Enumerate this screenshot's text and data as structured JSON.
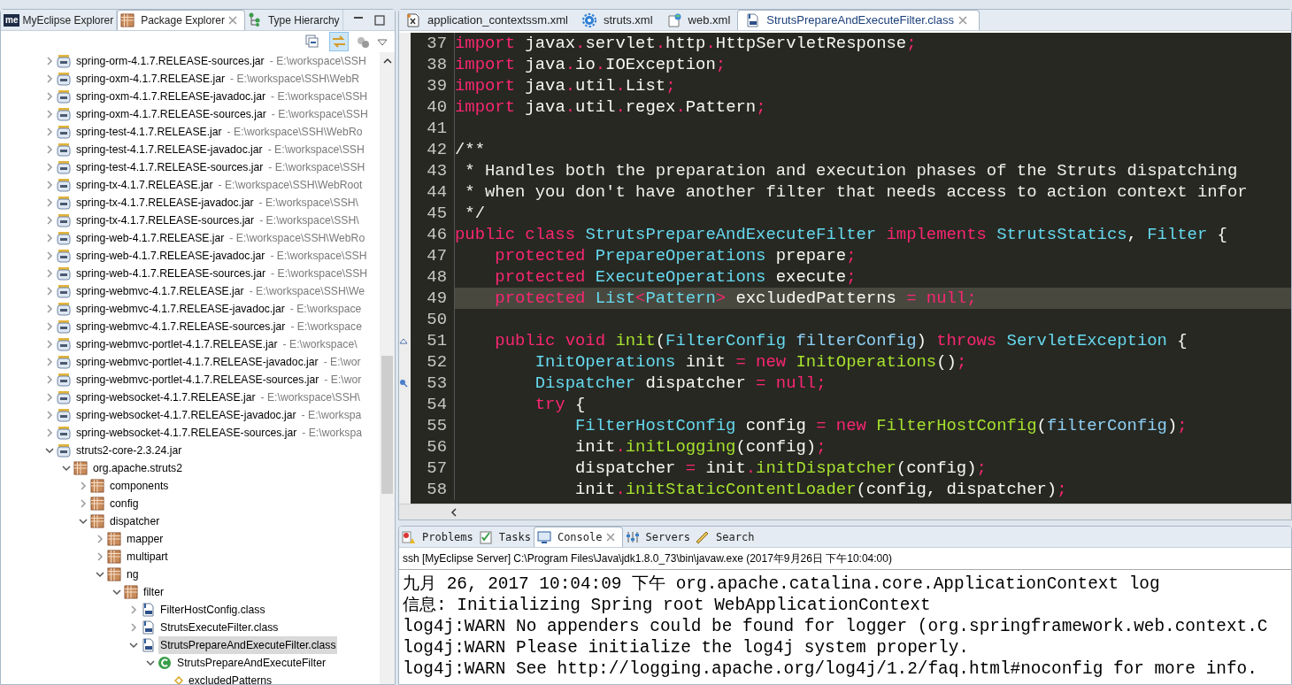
{
  "explorer": {
    "logo": "me",
    "tabs": [
      {
        "label": "MyEclipse Explorer",
        "selected": false
      },
      {
        "label": "Package Explorer",
        "selected": true
      },
      {
        "label": "Type Hierarchy",
        "selected": false
      }
    ],
    "link_with_editor": {
      "on": true
    },
    "tree": [
      {
        "label": "spring-orm-4.1.7.RELEASE-sources.jar",
        "path": "- E:\\workspace\\SSH",
        "kind": "jar",
        "expanded": false
      },
      {
        "label": "spring-oxm-4.1.7.RELEASE.jar",
        "path": "- E:\\workspace\\SSH\\WebR",
        "kind": "jar",
        "expanded": false
      },
      {
        "label": "spring-oxm-4.1.7.RELEASE-javadoc.jar",
        "path": "- E:\\workspace\\SSH",
        "kind": "jar",
        "expanded": false
      },
      {
        "label": "spring-oxm-4.1.7.RELEASE-sources.jar",
        "path": "- E:\\workspace\\SSH",
        "kind": "jar",
        "expanded": false
      },
      {
        "label": "spring-test-4.1.7.RELEASE.jar",
        "path": "- E:\\workspace\\SSH\\WebRo",
        "kind": "jar",
        "expanded": false
      },
      {
        "label": "spring-test-4.1.7.RELEASE-javadoc.jar",
        "path": "- E:\\workspace\\SSH",
        "kind": "jar",
        "expanded": false
      },
      {
        "label": "spring-test-4.1.7.RELEASE-sources.jar",
        "path": "- E:\\workspace\\SSH",
        "kind": "jar",
        "expanded": false
      },
      {
        "label": "spring-tx-4.1.7.RELEASE.jar",
        "path": "- E:\\workspace\\SSH\\WebRoot",
        "kind": "jar",
        "expanded": false
      },
      {
        "label": "spring-tx-4.1.7.RELEASE-javadoc.jar",
        "path": "- E:\\workspace\\SSH\\",
        "kind": "jar",
        "expanded": false
      },
      {
        "label": "spring-tx-4.1.7.RELEASE-sources.jar",
        "path": "- E:\\workspace\\SSH\\",
        "kind": "jar",
        "expanded": false
      },
      {
        "label": "spring-web-4.1.7.RELEASE.jar",
        "path": "- E:\\workspace\\SSH\\WebRo",
        "kind": "jar",
        "expanded": false
      },
      {
        "label": "spring-web-4.1.7.RELEASE-javadoc.jar",
        "path": "- E:\\workspace\\SSH",
        "kind": "jar",
        "expanded": false
      },
      {
        "label": "spring-web-4.1.7.RELEASE-sources.jar",
        "path": "- E:\\workspace\\SSH",
        "kind": "jar",
        "expanded": false
      },
      {
        "label": "spring-webmvc-4.1.7.RELEASE.jar",
        "path": "- E:\\workspace\\SSH\\We",
        "kind": "jar",
        "expanded": false
      },
      {
        "label": "spring-webmvc-4.1.7.RELEASE-javadoc.jar",
        "path": "- E:\\workspace",
        "kind": "jar",
        "expanded": false
      },
      {
        "label": "spring-webmvc-4.1.7.RELEASE-sources.jar",
        "path": "- E:\\workspace",
        "kind": "jar",
        "expanded": false
      },
      {
        "label": "spring-webmvc-portlet-4.1.7.RELEASE.jar",
        "path": "- E:\\workspace\\",
        "kind": "jar",
        "expanded": false
      },
      {
        "label": "spring-webmvc-portlet-4.1.7.RELEASE-javadoc.jar",
        "path": "- E:\\wor",
        "kind": "jar",
        "expanded": false
      },
      {
        "label": "spring-webmvc-portlet-4.1.7.RELEASE-sources.jar",
        "path": "- E:\\wor",
        "kind": "jar",
        "expanded": false
      },
      {
        "label": "spring-websocket-4.1.7.RELEASE.jar",
        "path": "- E:\\workspace\\SSH\\",
        "kind": "jar",
        "expanded": false
      },
      {
        "label": "spring-websocket-4.1.7.RELEASE-javadoc.jar",
        "path": "- E:\\workspa",
        "kind": "jar",
        "expanded": false
      },
      {
        "label": "spring-websocket-4.1.7.RELEASE-sources.jar",
        "path": "- E:\\workspa",
        "kind": "jar",
        "expanded": false
      },
      {
        "label": "struts2-core-2.3.24.jar",
        "kind": "jar",
        "expanded": true,
        "children": [
          {
            "label": "org.apache.struts2",
            "kind": "package",
            "expanded": true,
            "children": [
              {
                "label": "components",
                "kind": "package",
                "expanded": false
              },
              {
                "label": "config",
                "kind": "package",
                "expanded": false
              },
              {
                "label": "dispatcher",
                "kind": "package",
                "expanded": true,
                "children": [
                  {
                    "label": "mapper",
                    "kind": "package",
                    "expanded": false
                  },
                  {
                    "label": "multipart",
                    "kind": "package",
                    "expanded": false
                  },
                  {
                    "label": "ng",
                    "kind": "package",
                    "expanded": true,
                    "children": [
                      {
                        "label": "filter",
                        "kind": "package",
                        "expanded": true,
                        "children": [
                          {
                            "label": "FilterHostConfig.class",
                            "kind": "classfile",
                            "expanded": false,
                            "selected": false
                          },
                          {
                            "label": "StrutsExecuteFilter.class",
                            "kind": "classfile",
                            "expanded": false,
                            "selected": false
                          },
                          {
                            "label": "StrutsPrepareAndExecuteFilter.class",
                            "kind": "classfile",
                            "expanded": true,
                            "selected": true,
                            "children": [
                              {
                                "label": "StrutsPrepareAndExecuteFilter",
                                "kind": "class",
                                "expanded": true,
                                "children": [
                                  {
                                    "label": "excludedPatterns",
                                    "kind": "field"
                                  }
                                ]
                              }
                            ]
                          }
                        ]
                      }
                    ]
                  }
                ]
              }
            ]
          }
        ]
      }
    ]
  },
  "editor": {
    "tabs": [
      {
        "label": "application_contextssm.xml",
        "selected": false
      },
      {
        "label": "struts.xml",
        "selected": false
      },
      {
        "label": "web.xml",
        "selected": false
      },
      {
        "label": "StrutsPrepareAndExecuteFilter.class",
        "selected": true
      }
    ],
    "lines": [
      {
        "number": "37",
        "tokens": [
          {
            "kind": "kw",
            "text": "import"
          },
          {
            "kind": "text",
            "text": " javax"
          },
          {
            "kind": "punct",
            "text": "."
          },
          {
            "kind": "text",
            "text": "servlet"
          },
          {
            "kind": "punct",
            "text": "."
          },
          {
            "kind": "text",
            "text": "http"
          },
          {
            "kind": "punct",
            "text": "."
          },
          {
            "kind": "text",
            "text": "HttpServletResponse"
          },
          {
            "kind": "punct",
            "text": ";"
          }
        ]
      },
      {
        "number": "38",
        "tokens": [
          {
            "kind": "kw",
            "text": "import"
          },
          {
            "kind": "text",
            "text": " java"
          },
          {
            "kind": "punct",
            "text": "."
          },
          {
            "kind": "text",
            "text": "io"
          },
          {
            "kind": "punct",
            "text": "."
          },
          {
            "kind": "text",
            "text": "IOException"
          },
          {
            "kind": "punct",
            "text": ";"
          }
        ]
      },
      {
        "number": "39",
        "tokens": [
          {
            "kind": "kw",
            "text": "import"
          },
          {
            "kind": "text",
            "text": " java"
          },
          {
            "kind": "punct",
            "text": "."
          },
          {
            "kind": "text",
            "text": "util"
          },
          {
            "kind": "punct",
            "text": "."
          },
          {
            "kind": "text",
            "text": "List"
          },
          {
            "kind": "punct",
            "text": ";"
          }
        ]
      },
      {
        "number": "40",
        "tokens": [
          {
            "kind": "kw",
            "text": "import"
          },
          {
            "kind": "text",
            "text": " java"
          },
          {
            "kind": "punct",
            "text": "."
          },
          {
            "kind": "text",
            "text": "util"
          },
          {
            "kind": "punct",
            "text": "."
          },
          {
            "kind": "text",
            "text": "regex"
          },
          {
            "kind": "punct",
            "text": "."
          },
          {
            "kind": "text",
            "text": "Pattern"
          },
          {
            "kind": "punct",
            "text": ";"
          }
        ]
      },
      {
        "number": "41"
      },
      {
        "number": "42",
        "tokens": [
          {
            "kind": "comment",
            "text": "/**"
          }
        ]
      },
      {
        "number": "43",
        "tokens": [
          {
            "kind": "comment",
            "text": " * Handles both the preparation and execution phases of the Struts dispatching"
          }
        ]
      },
      {
        "number": "44",
        "tokens": [
          {
            "kind": "comment",
            "text": " * when you don't have another filter that needs access to action context infor"
          }
        ]
      },
      {
        "number": "45",
        "tokens": [
          {
            "kind": "comment",
            "text": " */"
          }
        ]
      },
      {
        "number": "46",
        "tokens": [
          {
            "kind": "kw",
            "text": "public class"
          },
          {
            "kind": "type",
            "text": " StrutsPrepareAndExecuteFilter"
          },
          {
            "kind": "kw",
            "text": " implements"
          },
          {
            "kind": "type",
            "text": " StrutsStatics"
          },
          {
            "kind": "text",
            "text": ", "
          },
          {
            "kind": "type",
            "text": "Filter"
          },
          {
            "kind": "text",
            "text": " {"
          }
        ]
      },
      {
        "number": "47",
        "tokens": [
          {
            "kind": "kw",
            "text": "    protected"
          },
          {
            "kind": "type",
            "text": " PrepareOperations"
          },
          {
            "kind": "text",
            "text": " prepare"
          },
          {
            "kind": "punct",
            "text": ";"
          }
        ]
      },
      {
        "number": "48",
        "tokens": [
          {
            "kind": "kw",
            "text": "    protected"
          },
          {
            "kind": "type",
            "text": " ExecuteOperations"
          },
          {
            "kind": "text",
            "text": " execute"
          },
          {
            "kind": "punct",
            "text": ";"
          }
        ]
      },
      {
        "number": "49",
        "highlighted": true,
        "tokens": [
          {
            "kind": "kw",
            "text": "    protected"
          },
          {
            "kind": "type",
            "text": " List"
          },
          {
            "kind": "punct",
            "text": "<"
          },
          {
            "kind": "type",
            "text": "Pattern"
          },
          {
            "kind": "punct",
            "text": ">"
          },
          {
            "kind": "text",
            "text": " excludedPatterns "
          },
          {
            "kind": "punct",
            "text": "="
          },
          {
            "kind": "kw",
            "text": " null"
          },
          {
            "kind": "punct",
            "text": ";"
          }
        ]
      },
      {
        "number": "50"
      },
      {
        "number": "51",
        "tokens": [
          {
            "kind": "kw",
            "text": "    public void"
          },
          {
            "kind": "call",
            "text": " init"
          },
          {
            "kind": "text",
            "text": "("
          },
          {
            "kind": "type",
            "text": "FilterConfig"
          },
          {
            "kind": "param",
            "text": " filterConfig"
          },
          {
            "kind": "text",
            "text": ") "
          },
          {
            "kind": "kw",
            "text": "throws"
          },
          {
            "kind": "type",
            "text": " ServletException"
          },
          {
            "kind": "text",
            "text": " {"
          }
        ]
      },
      {
        "number": "52",
        "tokens": [
          {
            "kind": "type",
            "text": "        InitOperations"
          },
          {
            "kind": "text",
            "text": " init "
          },
          {
            "kind": "punct",
            "text": "="
          },
          {
            "kind": "kw",
            "text": " new"
          },
          {
            "kind": "call",
            "text": " InitOperations"
          },
          {
            "kind": "text",
            "text": "()"
          },
          {
            "kind": "punct",
            "text": ";"
          }
        ]
      },
      {
        "number": "53",
        "tokens": [
          {
            "kind": "type",
            "text": "        Dispatcher"
          },
          {
            "kind": "text",
            "text": " dispatcher "
          },
          {
            "kind": "punct",
            "text": "="
          },
          {
            "kind": "kw",
            "text": " null"
          },
          {
            "kind": "punct",
            "text": ";"
          }
        ]
      },
      {
        "number": "54",
        "tokens": [
          {
            "kind": "kw",
            "text": "        try"
          },
          {
            "kind": "text",
            "text": " {"
          }
        ]
      },
      {
        "number": "55",
        "tokens": [
          {
            "kind": "type",
            "text": "            FilterHostConfig"
          },
          {
            "kind": "text",
            "text": " config "
          },
          {
            "kind": "punct",
            "text": "="
          },
          {
            "kind": "kw",
            "text": " new"
          },
          {
            "kind": "call",
            "text": " FilterHostConfig"
          },
          {
            "kind": "text",
            "text": "("
          },
          {
            "kind": "param",
            "text": "filterConfig"
          },
          {
            "kind": "text",
            "text": ")"
          },
          {
            "kind": "punct",
            "text": ";"
          }
        ]
      },
      {
        "number": "56",
        "tokens": [
          {
            "kind": "text",
            "text": "            init"
          },
          {
            "kind": "punct",
            "text": "."
          },
          {
            "kind": "call",
            "text": "initLogging"
          },
          {
            "kind": "text",
            "text": "(config)"
          },
          {
            "kind": "punct",
            "text": ";"
          }
        ]
      },
      {
        "number": "57",
        "tokens": [
          {
            "kind": "text",
            "text": "            dispatcher "
          },
          {
            "kind": "punct",
            "text": "="
          },
          {
            "kind": "text",
            "text": " init"
          },
          {
            "kind": "punct",
            "text": "."
          },
          {
            "kind": "call",
            "text": "initDispatcher"
          },
          {
            "kind": "text",
            "text": "(config)"
          },
          {
            "kind": "punct",
            "text": ";"
          }
        ]
      },
      {
        "number": "58",
        "tokens": [
          {
            "kind": "text",
            "text": "            init"
          },
          {
            "kind": "punct",
            "text": "."
          },
          {
            "kind": "call",
            "text": "initStaticContentLoader"
          },
          {
            "kind": "text",
            "text": "(config, dispatcher)"
          },
          {
            "kind": "punct",
            "text": ";"
          }
        ]
      }
    ]
  },
  "console": {
    "tabs": [
      {
        "label": "Problems",
        "selected": false
      },
      {
        "label": "Tasks",
        "selected": false
      },
      {
        "label": "Console",
        "selected": true
      },
      {
        "label": "Servers",
        "selected": false
      },
      {
        "label": "Search",
        "selected": false
      }
    ],
    "header": "ssh [MyEclipse Server] C:\\Program Files\\Java\\jdk1.8.0_73\\bin\\javaw.exe (2017年9月26日 下午10:04:00)",
    "lines": [
      "九月 26, 2017 10:04:09 下午 org.apache.catalina.core.ApplicationContext log",
      "信息: Initializing Spring root WebApplicationContext",
      "log4j:WARN No appenders could be found for logger (org.springframework.web.context.C",
      "log4j:WARN Please initialize the log4j system properly.",
      "log4j:WARN See http://logging.apache.org/log4j/1.2/faq.html#noconfig for more info."
    ]
  }
}
